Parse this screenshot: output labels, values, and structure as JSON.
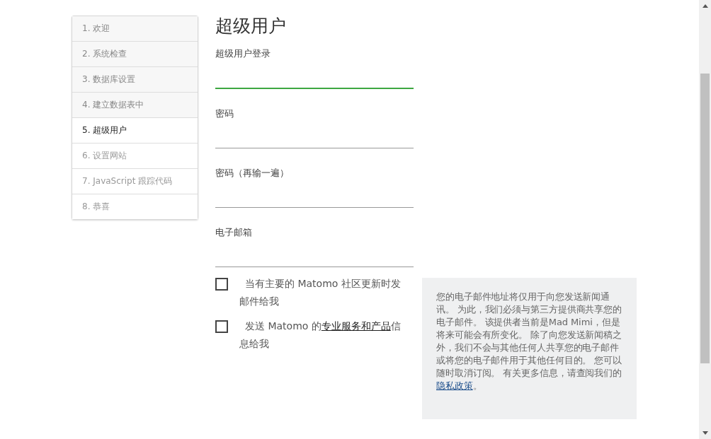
{
  "steps": [
    {
      "label": "1. 欢迎",
      "completed": true,
      "selected": false
    },
    {
      "label": "2. 系统检查",
      "completed": true,
      "selected": false
    },
    {
      "label": "3. 数据库设置",
      "completed": true,
      "selected": false
    },
    {
      "label": "4. 建立数据表中",
      "completed": true,
      "selected": false
    },
    {
      "label": "5. 超级用户",
      "completed": false,
      "selected": true
    },
    {
      "label": "6. 设置网站",
      "completed": false,
      "selected": false
    },
    {
      "label": "7. JavaScript 跟踪代码",
      "completed": false,
      "selected": false
    },
    {
      "label": "8. 恭喜",
      "completed": false,
      "selected": false
    }
  ],
  "heading": "超级用户",
  "fields": [
    {
      "label": "超级用户登录",
      "focused": true
    },
    {
      "label": "密码",
      "focused": false
    },
    {
      "label": "密码（再输一遍）",
      "focused": false
    },
    {
      "label": "电子邮箱",
      "focused": false
    }
  ],
  "checkboxes": [
    {
      "text": "当有主要的 Matomo 社区更新时发邮件给我",
      "checked": false
    },
    {
      "text": "发送 Matomo 的",
      "link": "专业服务和产品",
      "text_after": "信息给我",
      "checked": false
    }
  ],
  "info": {
    "text": "您的电子邮件地址将仅用于向您发送新闻通讯。 为此，我们必须与第三方提供商共享您的电子邮件。 该提供者当前是Mad Mimi，但是将来可能会有所变化。 除了向您发送新闻稿之外，我们不会与其他任何人共享您的电子邮件或将您的电子邮件用于其他任何目的。 您可以随时取消订阅。 有关更多信息，请查阅我们的",
    "link": "隐私政策",
    "text_after": "。"
  }
}
